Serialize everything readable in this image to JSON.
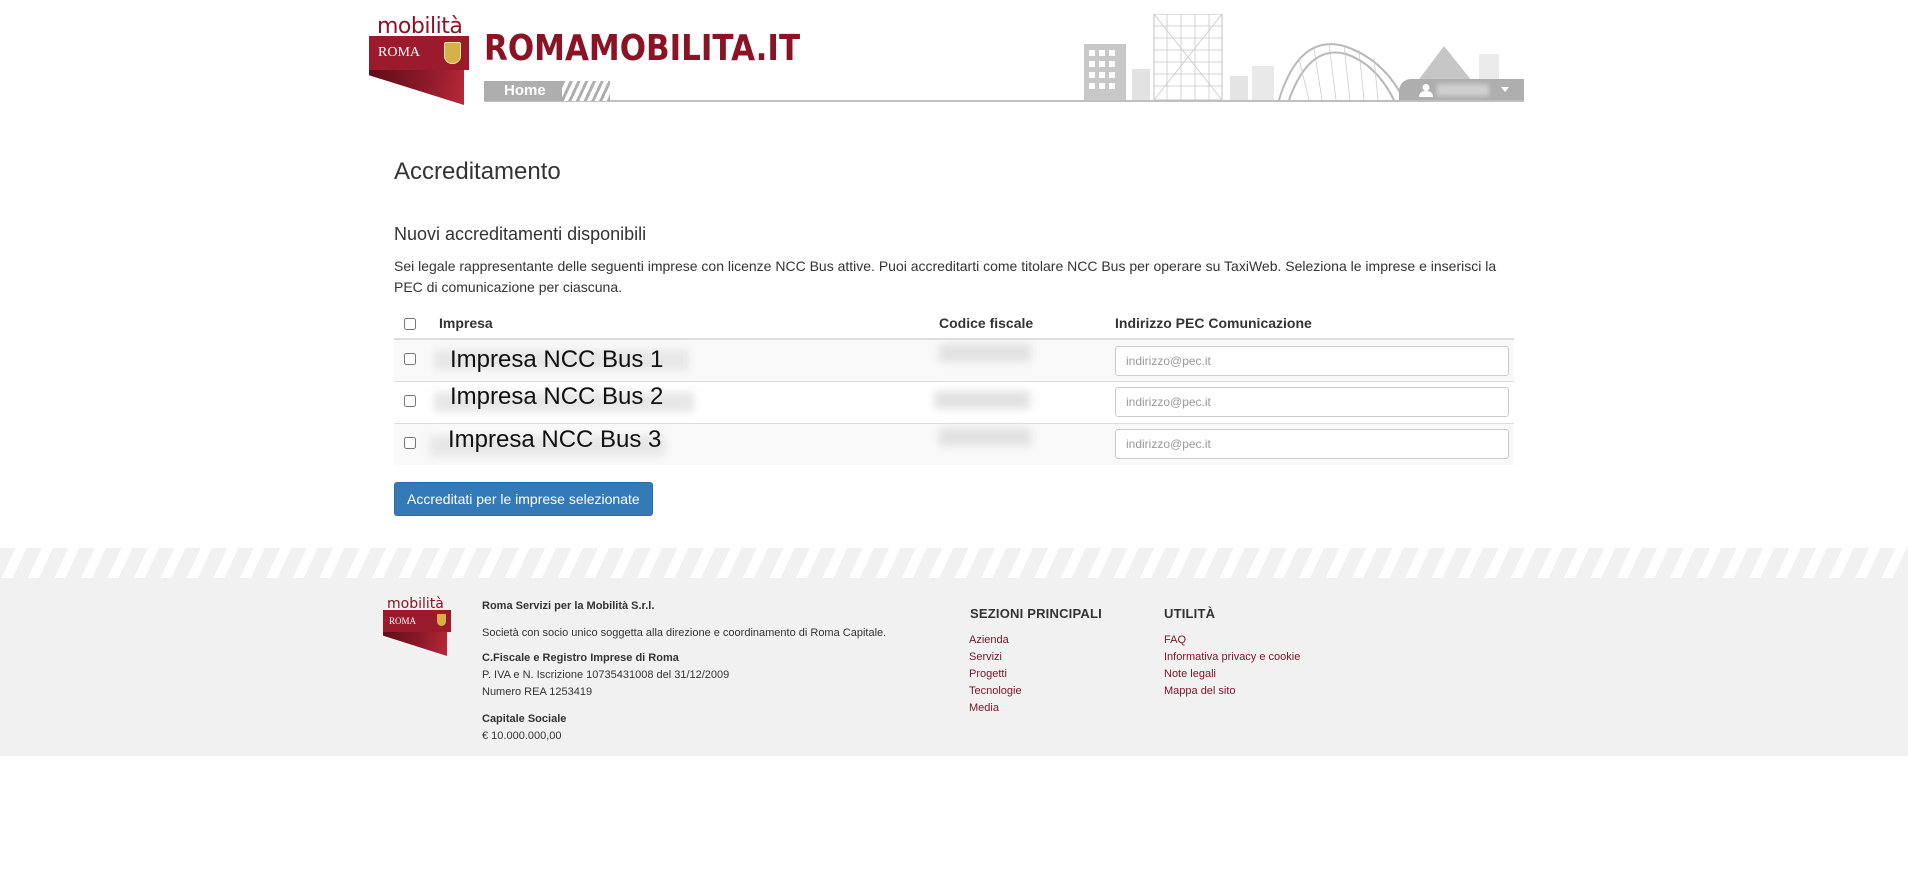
{
  "header": {
    "logo_word": "mobilità",
    "logo_band": "ROMA",
    "site_title": "ROMAMOBILITA.IT",
    "home_tab": "Home"
  },
  "main": {
    "page_title": "Accreditamento",
    "section_title": "Nuovi accreditamenti disponibili",
    "intro": "Sei legale rappresentante delle seguenti imprese con licenze NCC Bus attive. Puoi accreditarti come titolare NCC Bus per operare su TaxiWeb. Seleziona le imprese e inserisci la PEC di comunicazione per ciascuna.",
    "table": {
      "headers": [
        "Impresa",
        "Codice fiscale",
        "Indirizzo PEC Comunicazione"
      ],
      "rows": [
        {
          "impresa": "Impresa NCC Bus 1",
          "pec_placeholder": "indirizzo@pec.it"
        },
        {
          "impresa": "Impresa NCC Bus 2",
          "pec_placeholder": "indirizzo@pec.it"
        },
        {
          "impresa": "Impresa NCC Bus 3",
          "pec_placeholder": "indirizzo@pec.it"
        }
      ]
    },
    "submit_label": "Accreditati per le imprese selezionate"
  },
  "footer": {
    "logo_word": "mobilità",
    "logo_band": "ROMA",
    "company_name": "Roma Servizi per la Mobilità S.r.l.",
    "company_desc": "Società con socio unico soggetta alla direzione e coordinamento di Roma Capitale.",
    "registry_title": "C.Fiscale e Registro Imprese di Roma",
    "registry_line1": "P. IVA e N. Iscrizione 10735431008 del 31/12/2009",
    "registry_line2": "Numero REA 1253419",
    "capital_title": "Capitale Sociale",
    "capital_value": "€ 10.000.000,00",
    "sections_title": "SEZIONI PRINCIPALI",
    "sections": [
      "Azienda",
      "Servizi",
      "Progetti",
      "Tecnologie",
      "Media"
    ],
    "utility_title": "UTILITÀ",
    "utility": [
      "FAQ",
      "Informativa privacy e cookie",
      "Note legali",
      "Mappa del sito"
    ]
  },
  "colors": {
    "brand": "#8a1325",
    "button": "#337ab7",
    "link": "#7a1426"
  }
}
